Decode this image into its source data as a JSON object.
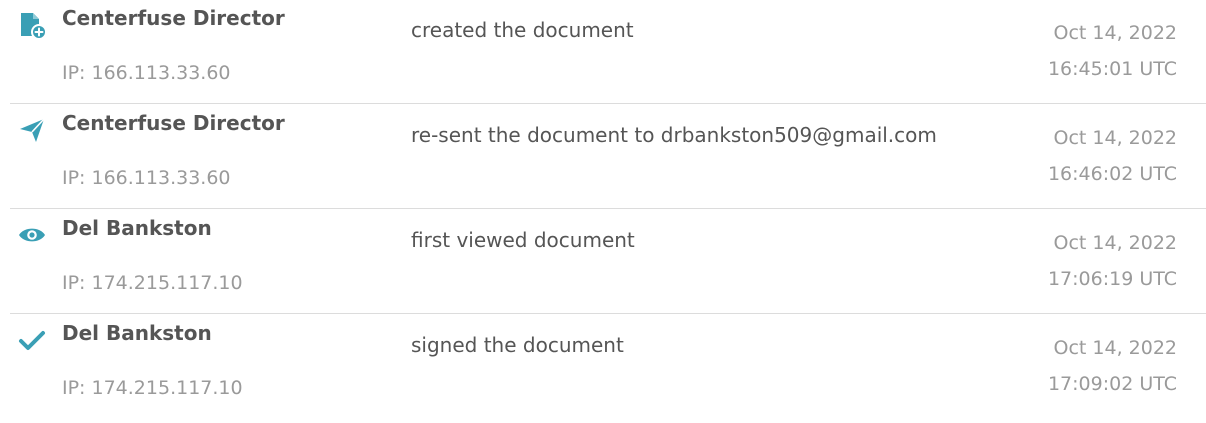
{
  "colors": {
    "accent": "#3a9fb5",
    "text_primary": "#555555",
    "text_secondary": "#9a9a9a",
    "divider": "#dcdcdc"
  },
  "events": [
    {
      "icon": "file-add-icon",
      "actor": "Centerfuse Director",
      "ip": "IP: 166.113.33.60",
      "action": "created the document",
      "date": "Oct 14, 2022",
      "time": "16:45:01 UTC"
    },
    {
      "icon": "send-icon",
      "actor": "Centerfuse Director",
      "ip": "IP: 166.113.33.60",
      "action": "re-sent the document to drbankston509@gmail.com",
      "date": "Oct 14, 2022",
      "time": "16:46:02 UTC"
    },
    {
      "icon": "eye-icon",
      "actor": "Del Bankston",
      "ip": "IP: 174.215.117.10",
      "action": "first viewed document",
      "date": "Oct 14, 2022",
      "time": "17:06:19 UTC"
    },
    {
      "icon": "checkmark-icon",
      "actor": "Del Bankston",
      "ip": "IP: 174.215.117.10",
      "action": "signed the document",
      "date": "Oct 14, 2022",
      "time": "17:09:02 UTC"
    }
  ]
}
